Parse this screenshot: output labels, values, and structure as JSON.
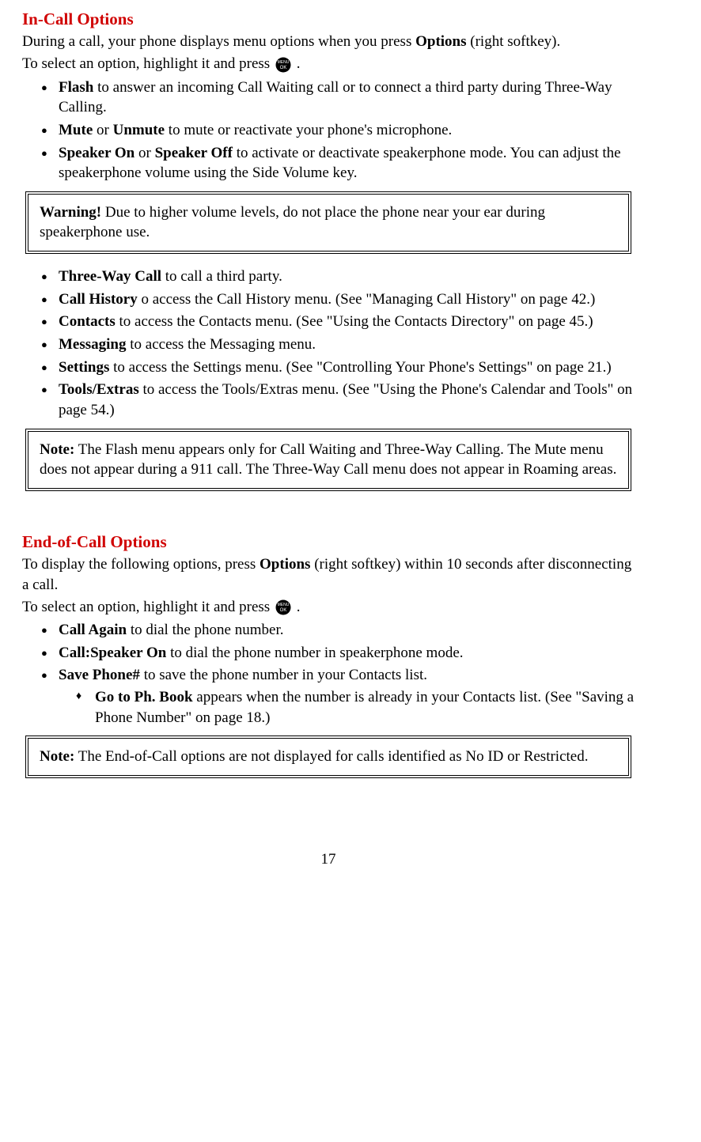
{
  "section1": {
    "heading": "In-Call Options",
    "intro_pre": "During a call, your phone displays menu options when you press ",
    "intro_bold": "Options",
    "intro_post": " (right softkey).",
    "intro2_pre": "To select an option, highlight it and press ",
    "intro2_post": " .",
    "bullets_a": [
      {
        "bold": "Flash",
        "rest": " to answer an incoming Call Waiting call or to connect a third party during Three-Way Calling."
      },
      {
        "bold": "Mute",
        "mid": " or ",
        "bold2": "Unmute",
        "rest": " to mute or reactivate your phone's microphone."
      },
      {
        "bold": "Speaker On",
        "mid": " or ",
        "bold2": "Speaker Off",
        "rest": " to activate or deactivate speakerphone mode. You can adjust the speakerphone volume using the Side Volume key."
      }
    ],
    "warning_label": "Warning!",
    "warning_text": " Due to higher volume levels, do not place the phone near your ear during speakerphone use.",
    "bullets_b": [
      {
        "bold": "Three-Way Call",
        "rest": " to call a third party."
      },
      {
        "bold": "Call History",
        "rest": " o access the Call History menu. (See \"Managing Call History\" on page 42.)"
      },
      {
        "bold": "Contacts",
        "rest": " to access the Contacts menu. (See \"Using the Contacts Directory\" on page 45.)"
      },
      {
        "bold": "Messaging",
        "rest": " to access the Messaging menu."
      },
      {
        "bold": "Settings",
        "rest": " to access the Settings menu. (See \"Controlling Your Phone's Settings\" on page 21.)"
      },
      {
        "bold": "Tools/Extras",
        "rest": " to access the Tools/Extras menu. (See \"Using the Phone's Calendar and Tools\" on page 54.)"
      }
    ],
    "note_label": "Note:",
    "note_text": " The Flash menu appears only for Call Waiting and Three-Way Calling. The Mute menu does not appear during a 911 call. The Three-Way Call menu does not appear in Roaming areas."
  },
  "section2": {
    "heading": "End-of-Call Options",
    "intro_pre": "To display the following options, press ",
    "intro_bold": "Options",
    "intro_post": " (right softkey) within 10 seconds after disconnecting a call.",
    "intro2_pre": "To select an option, highlight it and press ",
    "intro2_post": " .",
    "bullets": [
      {
        "bold": "Call Again",
        "rest": " to dial the phone number."
      },
      {
        "bold": "Call:Speaker On",
        "rest": " to dial the phone number in speakerphone mode."
      },
      {
        "bold": "Save Phone#",
        "rest": " to save the phone number in your Contacts list."
      }
    ],
    "sub_bold": "Go to Ph. Book",
    "sub_rest": " appears when the number is already in your Contacts list. (See \"Saving a Phone Number\" on page 18.)",
    "note_label": "Note:",
    "note_text": " The End-of-Call options are not displayed for calls identified as No ID or Restricted."
  },
  "page_number": "17",
  "icons": {
    "menu_ok": {
      "top": "MENU",
      "bottom": "OK"
    }
  }
}
